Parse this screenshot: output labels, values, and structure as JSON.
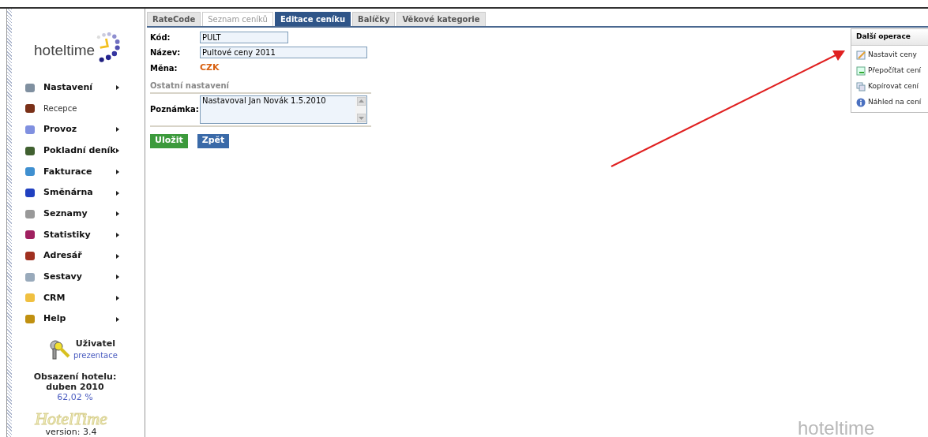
{
  "sidebar": {
    "logo": "hoteltime",
    "menu": [
      {
        "label": "Nastavení",
        "has_submenu": true
      },
      {
        "label": "Recepce",
        "has_submenu": false
      },
      {
        "label": "Provoz",
        "has_submenu": true
      },
      {
        "label": "Pokladní deník",
        "has_submenu": true
      },
      {
        "label": "Fakturace",
        "has_submenu": true
      },
      {
        "label": "Směnárna",
        "has_submenu": true
      },
      {
        "label": "Seznamy",
        "has_submenu": true
      },
      {
        "label": "Statistiky",
        "has_submenu": true
      },
      {
        "label": "Adresář",
        "has_submenu": true
      },
      {
        "label": "Sestavy",
        "has_submenu": true
      },
      {
        "label": "CRM",
        "has_submenu": true
      },
      {
        "label": "Help",
        "has_submenu": true
      }
    ],
    "user": {
      "label": "Uživatel",
      "name": "prezentace"
    },
    "occupancy": {
      "title": "Obsazení hotelu:",
      "period": "duben 2010",
      "value": "62,02 %"
    },
    "footer_logo": "HotelTime",
    "version": "version: 3.4"
  },
  "tabs": [
    {
      "label": "RateCode",
      "selected": false,
      "disabled": false
    },
    {
      "label": "Seznam ceníků",
      "selected": false,
      "disabled": true
    },
    {
      "label": "Editace ceníku",
      "selected": true,
      "disabled": false
    },
    {
      "label": "Balíčky",
      "selected": false,
      "disabled": false
    },
    {
      "label": "Věkové kategorie",
      "selected": false,
      "disabled": false
    }
  ],
  "form": {
    "code": {
      "label": "Kód:",
      "value": "PULT"
    },
    "name": {
      "label": "Název:",
      "value": "Pultové ceny 2011"
    },
    "currency": {
      "label": "Měna:",
      "value": "CZK"
    },
    "section": "Ostatní nastavení",
    "note": {
      "label": "Poznámka:",
      "value": "Nastavoval Jan Novák 1.5.2010"
    },
    "buttons": [
      {
        "label": "Uložit",
        "kind": "save"
      },
      {
        "label": "Zpět",
        "kind": "back"
      }
    ]
  },
  "operations": {
    "title": "Další operace",
    "items": [
      {
        "label": "Nastavit ceny",
        "kind": "edit"
      },
      {
        "label": "Přepočítat cení",
        "kind": "recalc"
      },
      {
        "label": "Kopírovat cení",
        "kind": "copy"
      },
      {
        "label": "Náhled na cení",
        "kind": "info"
      }
    ]
  },
  "background_logo": "hoteltime"
}
